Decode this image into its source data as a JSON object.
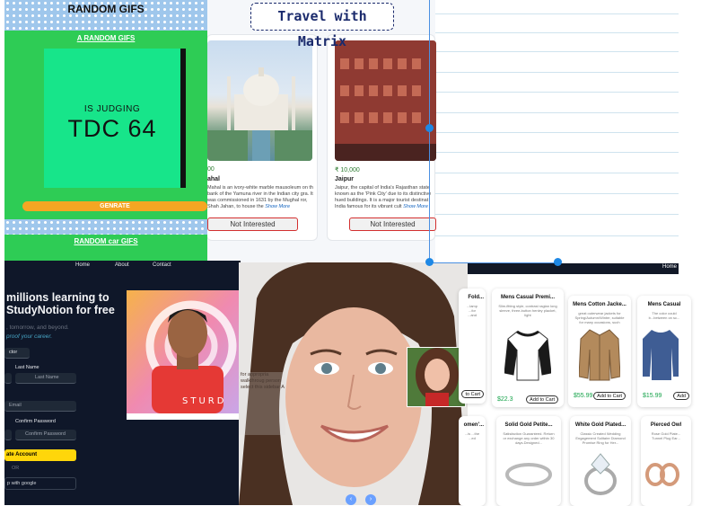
{
  "travel": {
    "title": "Travel with Matrix",
    "cards": [
      {
        "price": "00",
        "name": "ahal",
        "desc": "Mahal is an ivory-white marble mausoleum on th bank of the Yamuna river in the Indian city gra. It was commissioned in 1631 by the Mughal ror, Shah Jahan, to house the",
        "more": "Show More",
        "button": "Not Interested"
      },
      {
        "price": "₹ 10,000",
        "name": "Jaipur",
        "desc": "Jaipur, the capital of India's Rajasthan state known as the 'Pink City' due to its distinctive hued buildings. It is a major tourist destinat India famous for its vibrant cult",
        "more": "Show More",
        "button": "Not Interested"
      }
    ]
  },
  "gifs": {
    "title": "RANDOM GIFS",
    "link1": "A RANDOM GIFS",
    "small_text": "IS JUDGING",
    "big_text": "TDC 64",
    "button": "GENRATE",
    "link2": "RANDOM car GIFS"
  },
  "study": {
    "nav": [
      "Home",
      "About",
      "Contact"
    ],
    "heading_line1": "millions learning to",
    "heading_line2": "StudyNotion for free",
    "sub1": ", tomorrow, and beyond.",
    "sub2": "proof your career.",
    "tab": "ctor",
    "last_name_label": "Last Name",
    "last_name_ph": "Last Name",
    "email_ph": "Email",
    "confirm_label": "Confirm Password",
    "confirm_ph": "Confirm Password",
    "create_btn": "ate Account",
    "or": "OR",
    "google_btn": "p with google",
    "overlay_text": "for appropria walkthroug person select this sidebar A"
  },
  "shop": {
    "nav_home": "Home",
    "products": [
      {
        "title": "Fold...",
        "desc": "...lamp ...for ...and",
        "price": "",
        "cart": "to Cart"
      },
      {
        "title": "Mens Casual Premi...",
        "desc": "Slim-fitting style, contrast raglan long sleeve, three-button henley placket, light",
        "price": "$22.3",
        "cart": "Add to Cart"
      },
      {
        "title": "Mens Cotton Jacke...",
        "desc": "great outerwear jackets for Spring/Autumn/Winter, suitable for many occasions, such",
        "price": "$55.99",
        "cart": "Add to Cart"
      },
      {
        "title": "Mens Casual",
        "desc": "The color could b...between on sc...",
        "price": "$15.99",
        "cart": "Add"
      },
      {
        "title": "omen'...",
        "desc": "...is ...the ...ed",
        "price": "",
        "cart": ""
      },
      {
        "title": "Solid Gold Petite...",
        "desc": "Satisfaction Guaranteed. Return or exchange any order within 30 days.Designed...",
        "price": "",
        "cart": ""
      },
      {
        "title": "White Gold Plated...",
        "desc": "Classic Created Wedding Engagement Solitaire Diamond Promise Ring for Her...",
        "price": "",
        "cart": ""
      },
      {
        "title": "Pierced Owl",
        "desc": "Rose Gold Plate... Tunnel Plug Ear...",
        "price": "",
        "cart": ""
      }
    ]
  },
  "colors": {
    "gif_bg": "#2ecc55",
    "gif_box": "#17e58a",
    "study_bg": "#0f1729",
    "accent_yellow": "#ffd60a",
    "selection_blue": "#1e88e5"
  }
}
